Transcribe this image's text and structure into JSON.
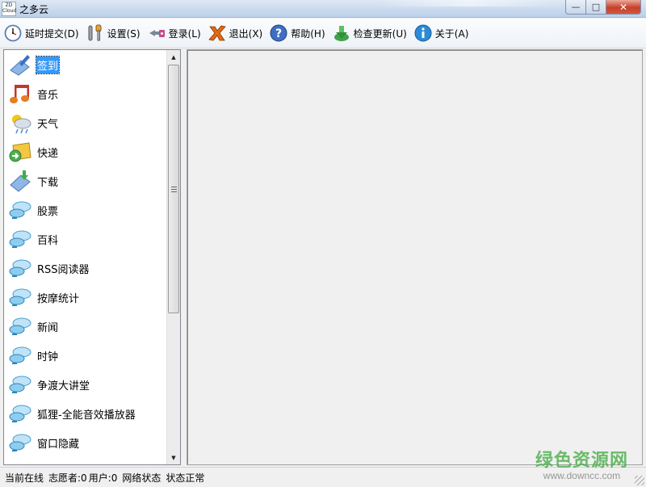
{
  "window": {
    "title": "之多云",
    "logo_text": [
      "ZD",
      "Cloud"
    ],
    "controls": {
      "minimize": "—",
      "maximize": "□",
      "close": "✕"
    }
  },
  "toolbar": {
    "items": [
      {
        "label": "延时提交(D)",
        "icon": "clock-icon"
      },
      {
        "label": "设置(S)",
        "icon": "wrench-icon"
      },
      {
        "label": "登录(L)",
        "icon": "login-icon"
      },
      {
        "label": "退出(X)",
        "icon": "exit-icon"
      },
      {
        "label": "帮助(H)",
        "icon": "help-icon"
      },
      {
        "label": "检查更新(U)",
        "icon": "update-icon"
      },
      {
        "label": "关于(A)",
        "icon": "info-icon"
      }
    ]
  },
  "nav": {
    "selected_index": 0,
    "items": [
      {
        "label": "签到",
        "icon": "checkin-icon"
      },
      {
        "label": "音乐",
        "icon": "music-icon"
      },
      {
        "label": "天气",
        "icon": "weather-icon"
      },
      {
        "label": "快递",
        "icon": "express-icon"
      },
      {
        "label": "下载",
        "icon": "download-icon"
      },
      {
        "label": "股票",
        "icon": "plugin-icon"
      },
      {
        "label": "百科",
        "icon": "plugin-icon"
      },
      {
        "label": "RSS阅读器",
        "icon": "plugin-icon"
      },
      {
        "label": "按摩统计",
        "icon": "plugin-icon"
      },
      {
        "label": "新闻",
        "icon": "plugin-icon"
      },
      {
        "label": "时钟",
        "icon": "plugin-icon"
      },
      {
        "label": "争渡大讲堂",
        "icon": "plugin-icon"
      },
      {
        "label": "狐狸-全能音效播放器",
        "icon": "plugin-icon"
      },
      {
        "label": "窗口隐藏",
        "icon": "plugin-icon"
      }
    ]
  },
  "statusbar": {
    "online_label": "当前在线",
    "volunteers": "志愿者:0",
    "users": "用户:0",
    "network_label": "网络状态",
    "status_text": "状态正常"
  },
  "watermark": {
    "brand": "绿色资源网",
    "url": "www.downcc.com"
  },
  "colors": {
    "selection": "#3399ff",
    "watermark_green": "#3caa3c"
  }
}
